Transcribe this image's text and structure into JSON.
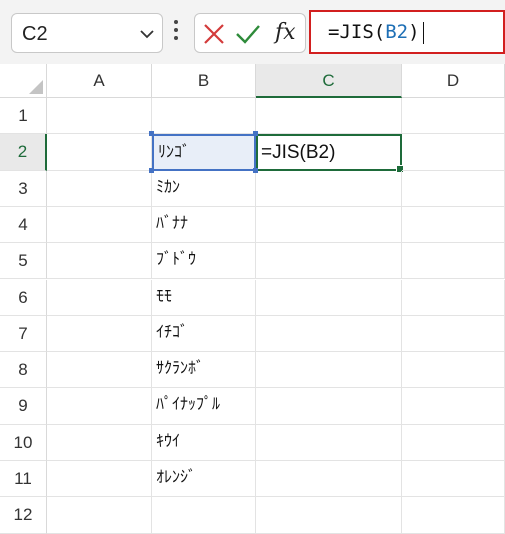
{
  "formula_bar": {
    "name_box": "C2",
    "formula_prefix": "=JIS(",
    "formula_ref": "B2",
    "formula_suffix": ")",
    "fx_label": "fx"
  },
  "columns": [
    "A",
    "B",
    "C",
    "D"
  ],
  "rows": [
    "1",
    "2",
    "3",
    "4",
    "5",
    "6",
    "7",
    "8",
    "9",
    "10",
    "11",
    "12"
  ],
  "cells": {
    "B2": "ﾘﾝｺﾞ",
    "C2": "=JIS(B2)",
    "B3": "ﾐｶﾝ",
    "B4": "ﾊﾞﾅﾅ",
    "B5": "ﾌﾞﾄﾞｳ",
    "B6": "ﾓﾓ",
    "B7": "ｲﾁｺﾞ",
    "B8": "ｻｸﾗﾝﾎﾞ",
    "B9": "ﾊﾟｲﾅｯﾌﾟﾙ",
    "B10": "ｷｳｲ",
    "B11": "ｵﾚﾝｼﾞ"
  },
  "colors": {
    "accent_green": "#1e6b3a",
    "highlight_red": "#d21f1f",
    "reference_blue": "#1e6fb5",
    "selection_blue": "#4472c4"
  },
  "icons": [
    "chevron-down-icon",
    "more-icon",
    "cancel-icon",
    "enter-icon",
    "insert-function-icon"
  ]
}
